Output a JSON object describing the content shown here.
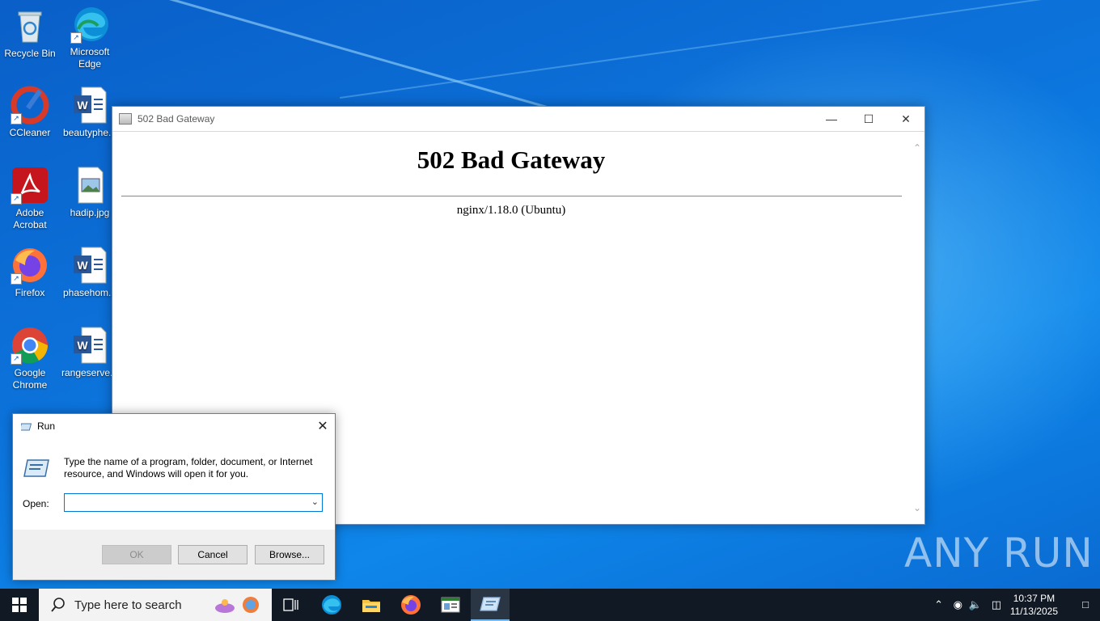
{
  "desktop": {
    "icons": [
      {
        "label": "Recycle Bin"
      },
      {
        "label": "Microsoft Edge"
      },
      {
        "label": "CCleaner"
      },
      {
        "label": "beautyphe..."
      },
      {
        "label": "Adobe Acrobat"
      },
      {
        "label": "hadip.jpg"
      },
      {
        "label": "Firefox"
      },
      {
        "label": "phasehom..."
      },
      {
        "label": "Google Chrome"
      },
      {
        "label": "rangeserve..."
      }
    ]
  },
  "browser_window": {
    "title": "502 Bad Gateway",
    "heading": "502 Bad Gateway",
    "server": "nginx/1.18.0 (Ubuntu)"
  },
  "run_dialog": {
    "title": "Run",
    "description": "Type the name of a program, folder, document, or Internet resource, and Windows will open it for you.",
    "open_label": "Open:",
    "open_value": "",
    "ok_label": "OK",
    "cancel_label": "Cancel",
    "browse_label": "Browse..."
  },
  "taskbar": {
    "search_placeholder": "Type here to search",
    "time": "10:37 PM",
    "date": "11/13/2025"
  },
  "watermark": "ANY RUN"
}
